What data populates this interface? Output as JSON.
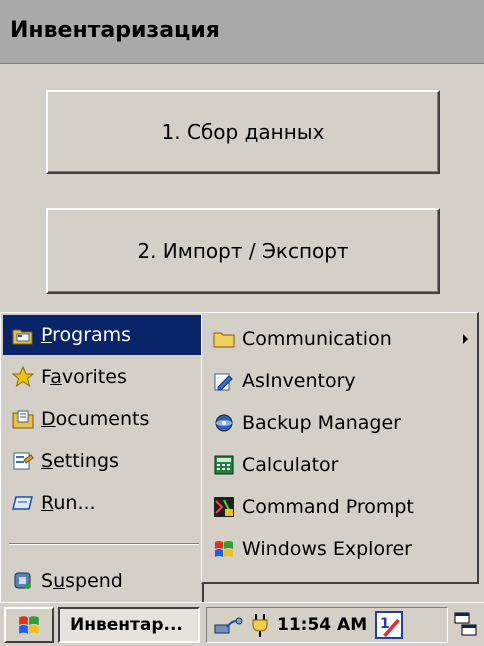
{
  "window": {
    "title": "Инвентаризация"
  },
  "main": {
    "buttons": [
      {
        "label": "1. Сбор данных"
      },
      {
        "label": "2. Импорт / Экспорт"
      }
    ]
  },
  "start_menu": {
    "items": [
      {
        "pre": "",
        "accel": "P",
        "post": "rograms",
        "icon": "programs-icon",
        "selected": true
      },
      {
        "pre": "F",
        "accel": "a",
        "post": "vorites",
        "icon": "star-icon"
      },
      {
        "pre": "",
        "accel": "D",
        "post": "ocuments",
        "icon": "documents-icon"
      },
      {
        "pre": "",
        "accel": "S",
        "post": "ettings",
        "icon": "settings-icon"
      },
      {
        "pre": "",
        "accel": "R",
        "post": "un...",
        "icon": "run-icon"
      },
      {
        "pre": "S",
        "accel": "u",
        "post": "spend",
        "icon": "suspend-icon"
      }
    ]
  },
  "programs_submenu": {
    "items": [
      {
        "label": "Communication",
        "icon": "folder-icon",
        "has_submenu": true
      },
      {
        "label": "AsInventory",
        "icon": "asinventory-icon"
      },
      {
        "label": "Backup Manager",
        "icon": "backup-icon"
      },
      {
        "label": "Calculator",
        "icon": "calculator-icon"
      },
      {
        "label": "Command Prompt",
        "icon": "command-prompt-icon"
      },
      {
        "label": "Windows Explorer",
        "icon": "windows-explorer-icon"
      }
    ]
  },
  "taskbar": {
    "task_label": "Инвентар...",
    "clock": "11:54 AM",
    "icons": [
      "windows-flag-icon",
      "network-icon",
      "power-plug-icon",
      "input-panel-icon",
      "desktop-switch-icon"
    ]
  },
  "colors": {
    "face": "#d4d0c8",
    "title_bar": "#a9a9a9",
    "selection": "#0a246a"
  }
}
